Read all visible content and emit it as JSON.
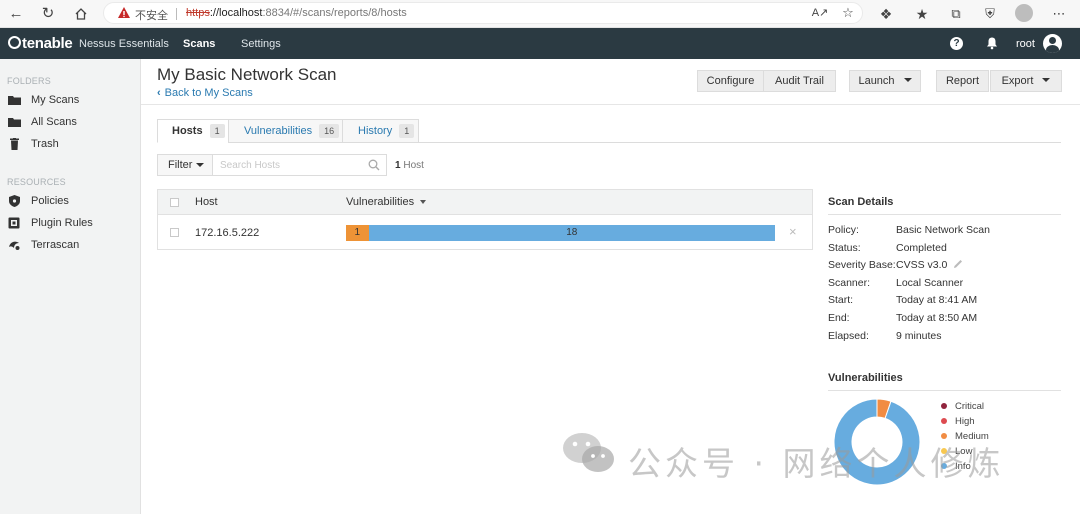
{
  "browser": {
    "insecure_label": "不安全",
    "url_scheme": "https",
    "url_host": "://localhost",
    "url_rest": ":8834/#/scans/reports/8/hosts"
  },
  "topnav": {
    "brand": "tenable",
    "product": "Nessus Essentials",
    "scans": "Scans",
    "settings": "Settings",
    "user": "root"
  },
  "sidebar": {
    "folders_heading": "FOLDERS",
    "resources_heading": "RESOURCES",
    "folders": [
      {
        "label": "My Scans",
        "icon": "folder-icon"
      },
      {
        "label": "All Scans",
        "icon": "folder-icon"
      },
      {
        "label": "Trash",
        "icon": "trash-icon"
      }
    ],
    "resources": [
      {
        "label": "Policies",
        "icon": "shield-icon"
      },
      {
        "label": "Plugin Rules",
        "icon": "puzzle-icon"
      },
      {
        "label": "Terrascan",
        "icon": "terrascan-icon"
      }
    ]
  },
  "page": {
    "title": "My Basic Network Scan",
    "back_link": "Back to My Scans"
  },
  "toolbar": {
    "configure": "Configure",
    "audit_trail": "Audit Trail",
    "launch": "Launch",
    "report": "Report",
    "export": "Export"
  },
  "tabs": [
    {
      "label": "Hosts",
      "count": "1"
    },
    {
      "label": "Vulnerabilities",
      "count": "16"
    },
    {
      "label": "History",
      "count": "1"
    }
  ],
  "filter": {
    "label": "Filter",
    "search_placeholder": "Search Hosts",
    "count": "1",
    "count_suffix": "Host"
  },
  "table": {
    "columns": [
      "Host",
      "Vulnerabilities"
    ],
    "rows": [
      {
        "host": "172.16.5.222",
        "vuln_counts": {
          "critical": 0,
          "high": 0,
          "medium": 1,
          "low": 0,
          "info": 18
        },
        "medium_label": "1",
        "info_label": "18"
      }
    ]
  },
  "scan_details": {
    "title": "Scan Details",
    "fields": [
      {
        "label": "Policy:",
        "value": "Basic Network Scan"
      },
      {
        "label": "Status:",
        "value": "Completed"
      },
      {
        "label": "Severity Base:",
        "value": "CVSS v3.0"
      },
      {
        "label": "Scanner:",
        "value": "Local Scanner"
      },
      {
        "label": "Start:",
        "value": "Today at 8:41 AM"
      },
      {
        "label": "End:",
        "value": "Today at 8:50 AM"
      },
      {
        "label": "Elapsed:",
        "value": "9 minutes"
      }
    ]
  },
  "vulnerabilities_chart": {
    "title": "Vulnerabilities",
    "legend": [
      {
        "label": "Critical",
        "color": "#91243e"
      },
      {
        "label": "High",
        "color": "#dd4b50"
      },
      {
        "label": "Medium",
        "color": "#f18c43"
      },
      {
        "label": "Low",
        "color": "#f8c851"
      },
      {
        "label": "Info",
        "color": "#67acdf"
      }
    ]
  },
  "chart_data": {
    "type": "pie",
    "title": "Vulnerabilities",
    "categories": [
      "Critical",
      "High",
      "Medium",
      "Low",
      "Info"
    ],
    "values": [
      0,
      0,
      1,
      0,
      18
    ]
  },
  "watermark": {
    "text": "公众号 · 网络个人修炼"
  }
}
